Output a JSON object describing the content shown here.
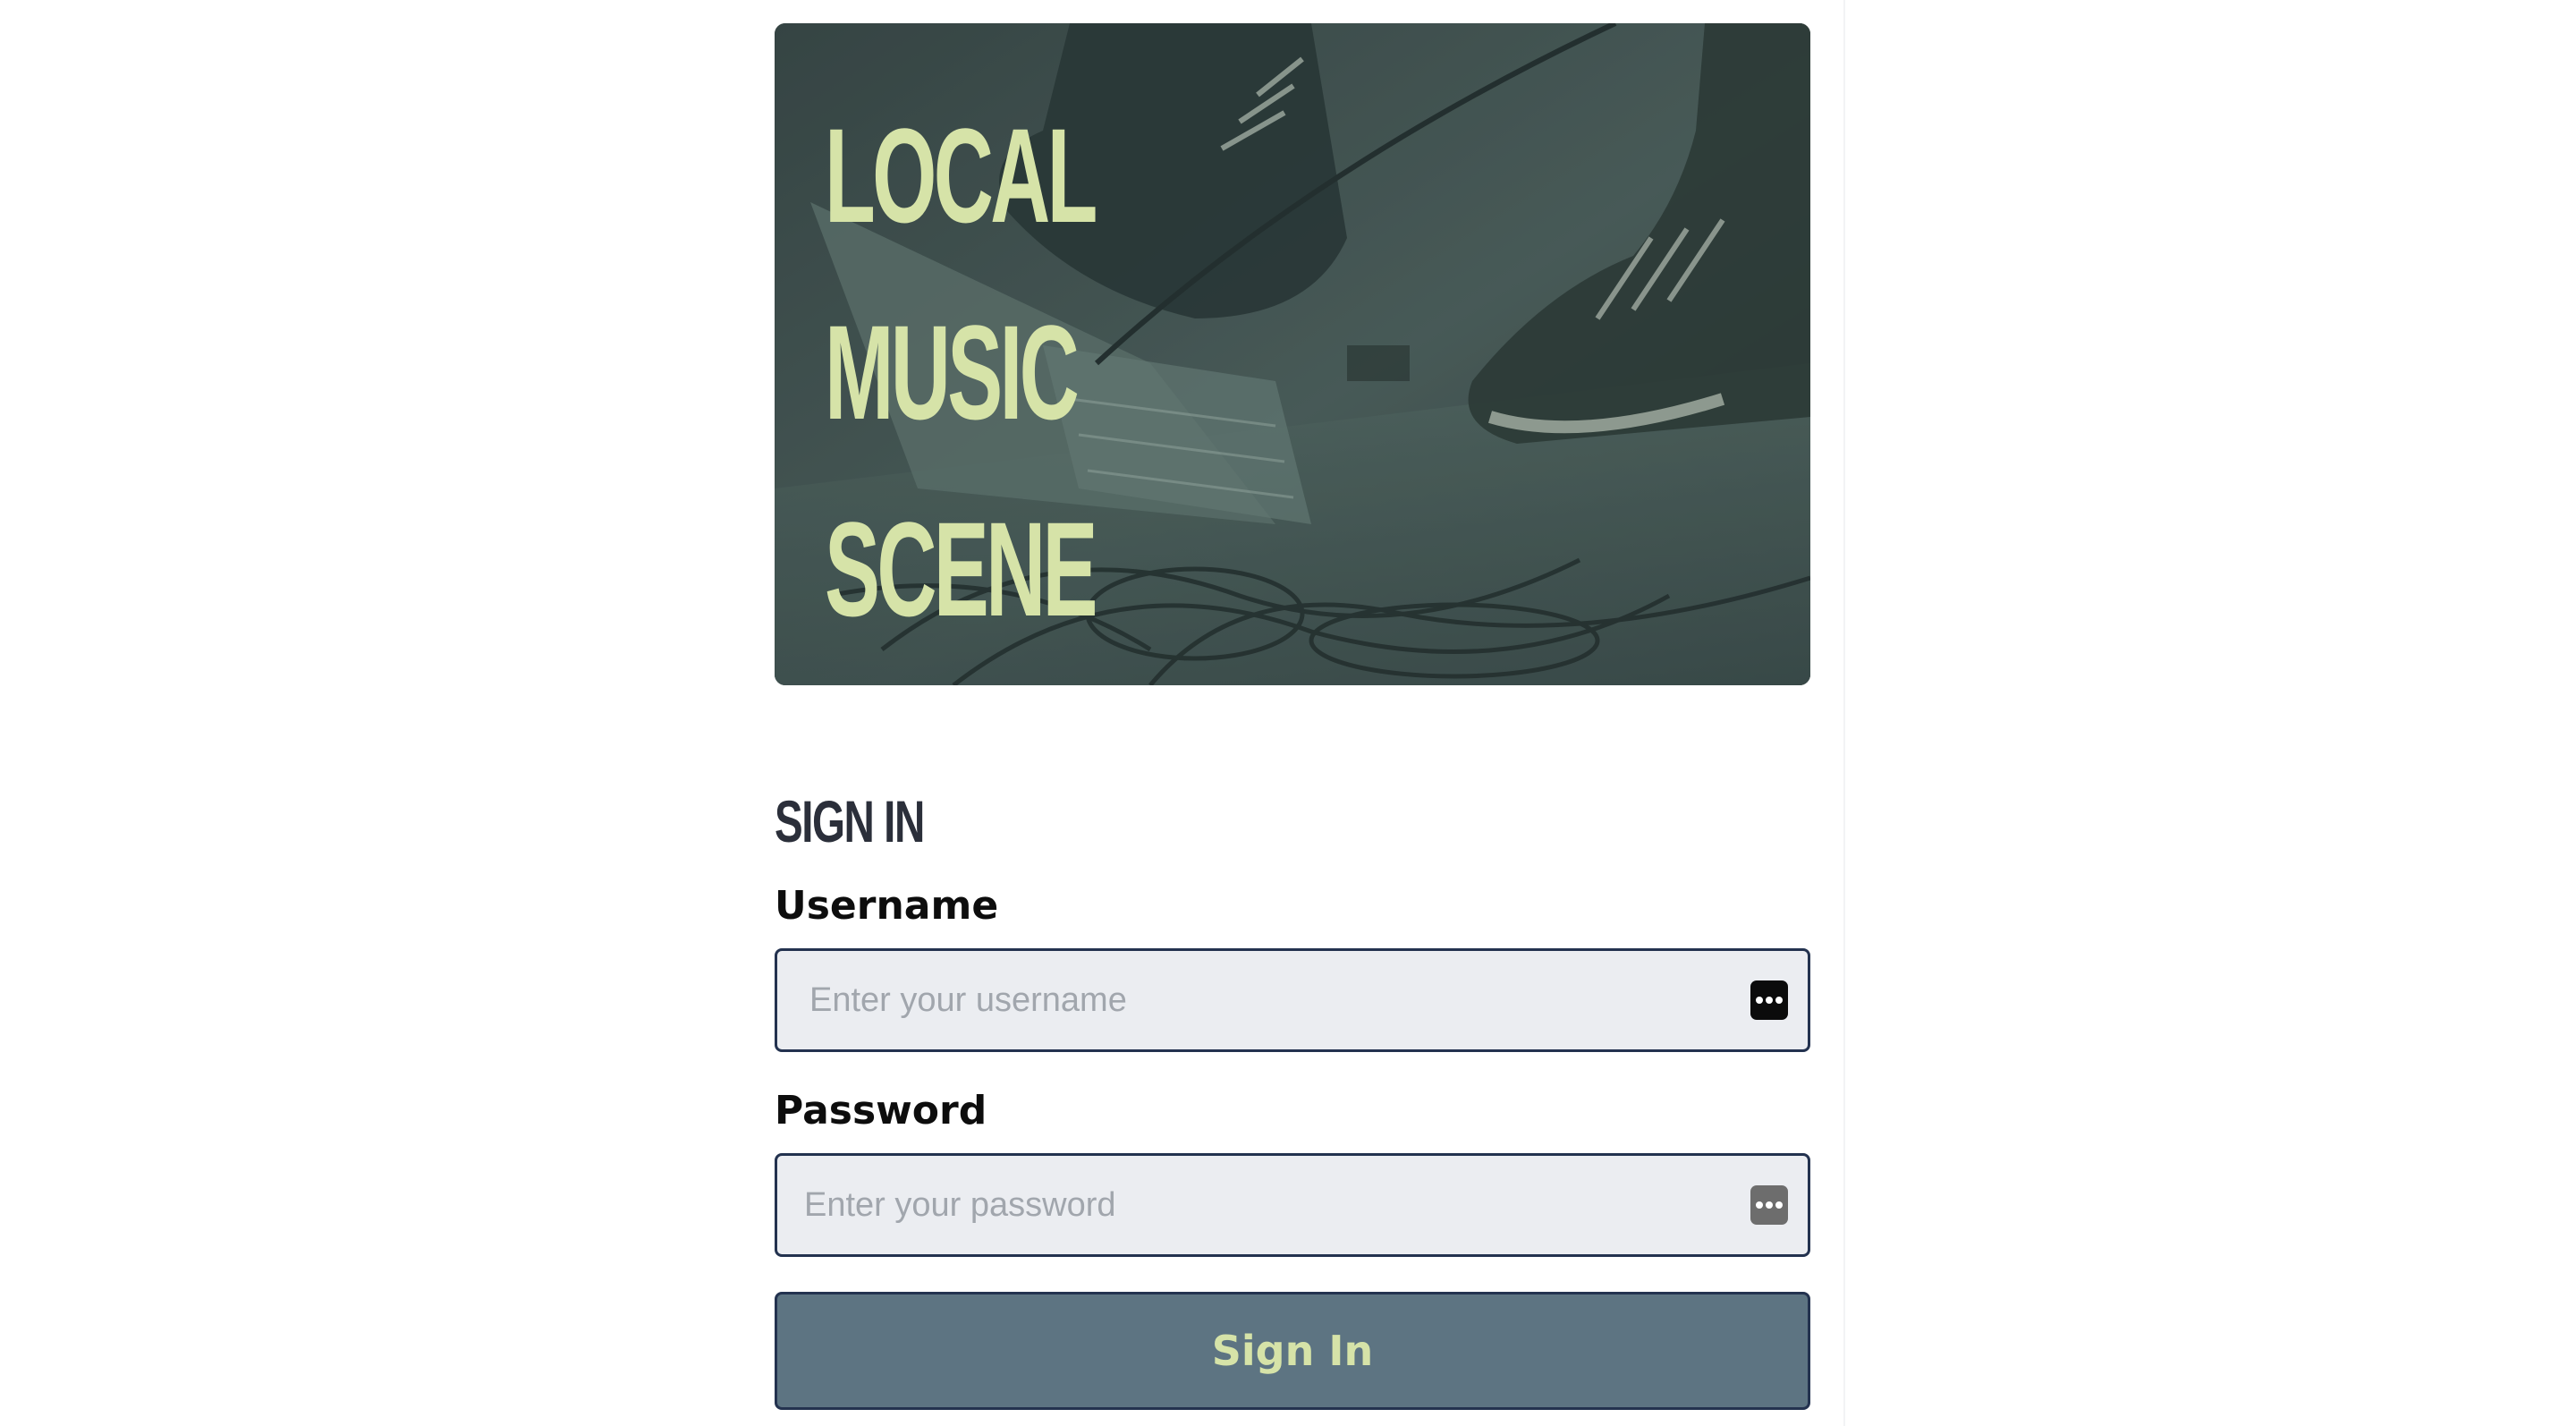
{
  "hero": {
    "title_lines": [
      "LOCAL",
      "MUSIC",
      "SCENE"
    ]
  },
  "form": {
    "heading": "SIGN IN",
    "username": {
      "label": "Username",
      "placeholder": "Enter your username",
      "value": ""
    },
    "password": {
      "label": "Password",
      "placeholder": "Enter your password",
      "value": ""
    },
    "submit_label": "Sign In"
  },
  "icons": {
    "password_manager": "password-manager-key-icon"
  },
  "colors": {
    "hero_text": "#d6e3a8",
    "heading": "#2b2f3a",
    "input_border": "#23324f",
    "input_background": "#ebedf1",
    "button_background": "#5d7482",
    "button_text": "#d6e3a8"
  }
}
